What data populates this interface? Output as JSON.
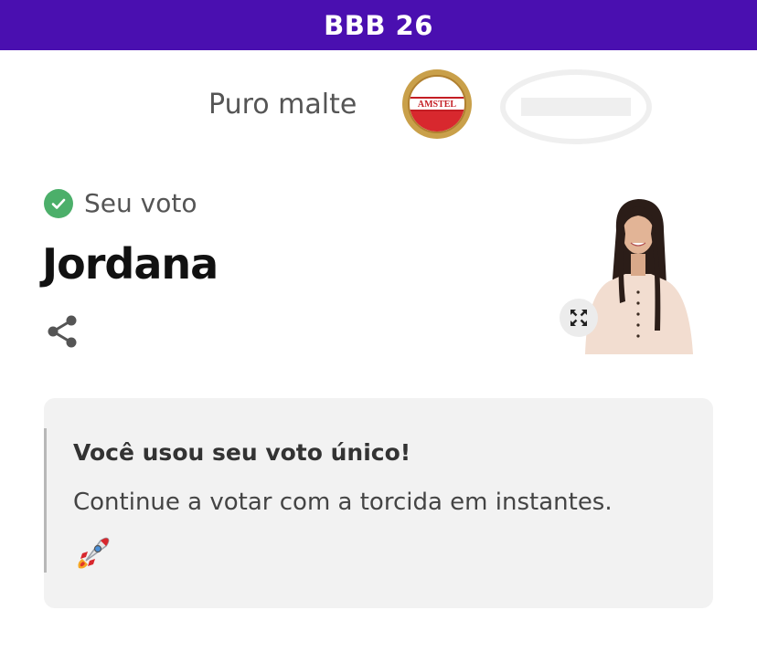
{
  "header": {
    "title": "BBB 26"
  },
  "sponsor": {
    "label": "Puro malte",
    "logo_text": "AMSTEL",
    "logo_icon": "amstel-logo"
  },
  "vote": {
    "status_label": "Seu voto",
    "status_icon": "check-circle-icon",
    "candidate_name": "Jordana",
    "share_icon": "share-icon",
    "expand_icon": "expand-icon"
  },
  "message": {
    "title": "Você usou seu voto único!",
    "body": "Continue a votar com a torcida em instantes.",
    "emoji_icon": "rocket-icon"
  },
  "colors": {
    "header_bg": "#4a0fb0",
    "check_green": "#4caf6a",
    "card_bg": "#f2f2f2"
  }
}
